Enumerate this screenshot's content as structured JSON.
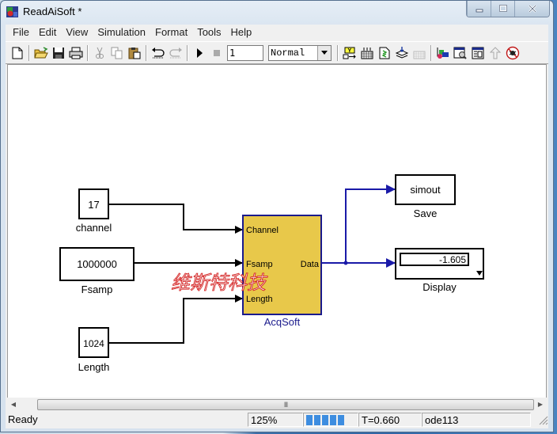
{
  "window": {
    "title": "ReadAiSoft *",
    "icons": {
      "app": "simulink-model-icon",
      "minimize": "minimize-icon",
      "maximize": "maximize-icon",
      "close": "close-icon"
    }
  },
  "menu": [
    "File",
    "Edit",
    "View",
    "Simulation",
    "Format",
    "Tools",
    "Help"
  ],
  "toolbar": {
    "buttons": [
      {
        "name": "new-model",
        "icon": "new-file-icon"
      },
      {
        "name": "open",
        "icon": "folder-open-icon"
      },
      {
        "name": "save",
        "icon": "floppy-disk-icon"
      },
      {
        "name": "print",
        "icon": "printer-icon"
      },
      {
        "name": "cut",
        "icon": "scissors-icon",
        "disabled": true
      },
      {
        "name": "copy",
        "icon": "copy-icon",
        "disabled": true
      },
      {
        "name": "paste",
        "icon": "clipboard-icon"
      },
      {
        "name": "undo",
        "icon": "undo-icon"
      },
      {
        "name": "redo",
        "icon": "redo-icon",
        "disabled": true
      },
      {
        "name": "start-simulation",
        "icon": "play-icon"
      },
      {
        "name": "stop-simulation",
        "icon": "stop-icon",
        "disabled": true
      }
    ],
    "stop_time": "1",
    "sim_mode": "Normal",
    "tools": [
      {
        "name": "build-model",
        "icon": "build-icon"
      },
      {
        "name": "build-subsystem",
        "icon": "grid-build-icon"
      },
      {
        "name": "update-diagram",
        "icon": "refresh-doc-icon"
      },
      {
        "name": "library-load",
        "icon": "layers-download-icon"
      },
      {
        "name": "incremental-build",
        "icon": "grid-disabled-icon",
        "disabled": true
      },
      {
        "name": "library-browser",
        "icon": "library-browser-icon"
      },
      {
        "name": "model-explorer",
        "icon": "model-explorer-icon"
      },
      {
        "name": "debugger",
        "icon": "debugger-icon"
      },
      {
        "name": "go-to-parent",
        "icon": "up-arrow-icon",
        "disabled": true
      },
      {
        "name": "toggle-breakpoint",
        "icon": "bug-icon"
      }
    ]
  },
  "diagram": {
    "blocks": {
      "channel": {
        "value": "17",
        "label": "channel"
      },
      "fsamp": {
        "value": "1000000",
        "label": "Fsamp"
      },
      "length": {
        "value": "1024",
        "label": "Length"
      },
      "acqsoft": {
        "label": "AcqSoft",
        "ports_in": [
          "Channel",
          "Fsamp",
          "Length"
        ],
        "port_out": "Data",
        "fill": "#e8c84a",
        "border": "#1a1a8c"
      },
      "save": {
        "value": "simout",
        "label": "Save"
      },
      "display": {
        "value": "-1.605",
        "label": "Display"
      }
    },
    "watermark": "维斯特科技",
    "signal_color_black": "#000000",
    "signal_color_blue": "#1a1aa8"
  },
  "scrollbar": {
    "thumb_glyph": "III"
  },
  "status": {
    "state": "Ready",
    "zoom": "125%",
    "progress_cells": 5,
    "time": "T=0.660",
    "solver": "ode113"
  }
}
